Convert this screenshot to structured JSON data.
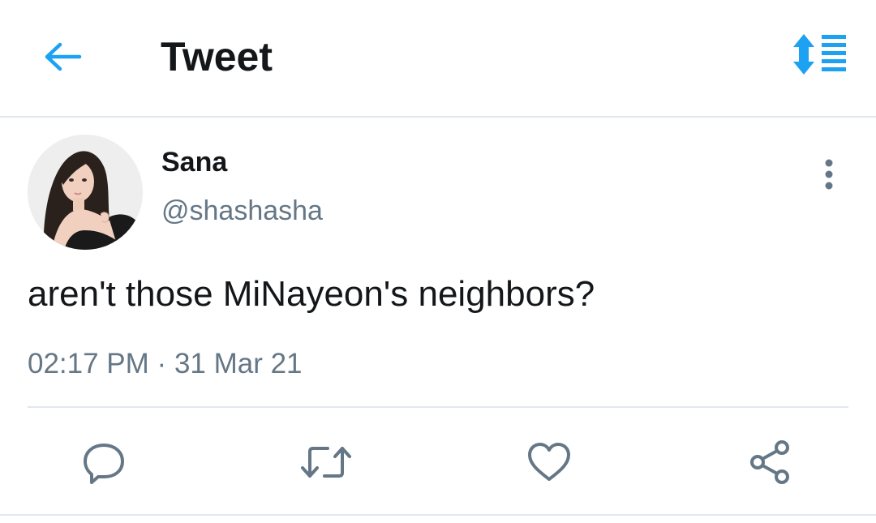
{
  "header": {
    "title": "Tweet",
    "back_icon": "arrow-left-icon",
    "sort_icon": "sort-order-icon"
  },
  "tweet": {
    "author": {
      "display_name": "Sana",
      "username": "@shashasha",
      "avatar_icon": "profile-photo"
    },
    "text": "aren't those MiNayeon's neighbors?",
    "time": "02:17 PM",
    "separator": "·",
    "date": "31 Mar 21",
    "more_icon": "more-vertical-icon"
  },
  "actions": [
    {
      "name": "reply",
      "icon": "reply-icon"
    },
    {
      "name": "retweet",
      "icon": "retweet-icon"
    },
    {
      "name": "like",
      "icon": "heart-icon"
    },
    {
      "name": "share",
      "icon": "share-icon"
    }
  ],
  "colors": {
    "accent": "#1da1f2",
    "text_primary": "#14171a",
    "text_secondary": "#657786",
    "divider": "#e1e8ed"
  }
}
